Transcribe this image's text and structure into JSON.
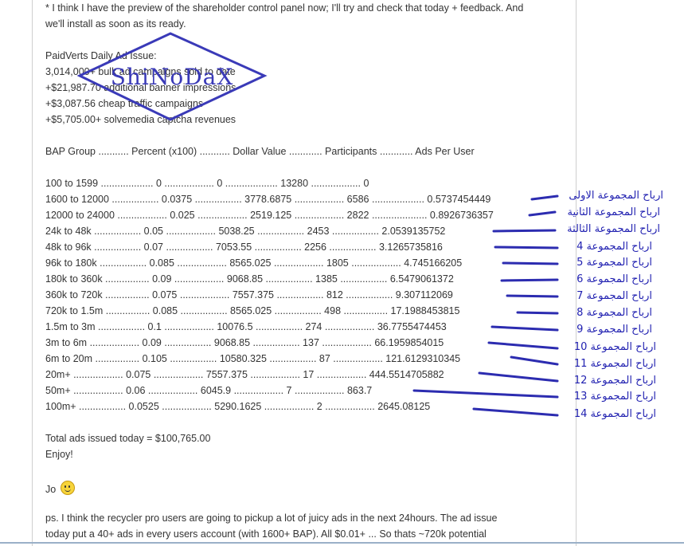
{
  "post": {
    "intro_line1": "* I think I have the preview of the shareholder control panel now; I'll try and check that today + feedback. And",
    "intro_line2": "we'll install as soon as its ready.",
    "issue_title": "PaidVerts Daily Ad Issue:",
    "issue_items": [
      "3,014,000+ bulk ad campaigns sold to date",
      "+$21,987.70 additional banner impressions",
      "+$3,087.56 cheap traffic campaigns",
      "+$5,705.00+ solvemedia captcha revenues"
    ],
    "table_header": "BAP Group ........... Percent (x100) ........... Dollar Value ............ Participants ............ Ads Per User",
    "table_rows": [
      "100 to 1599 ................... 0 .................. 0 ................... 13280 .................. 0",
      "1600 to 12000 ................. 0.0375 ................. 3778.6875 .................. 6586 ................... 0.5737454449",
      "12000 to 24000 .................. 0.025 .................. 2519.125 .................. 2822 .................... 0.8926736357",
      "24k to 48k ................. 0.05 .................. 5038.25 ................. 2453 ................. 2.0539135752",
      "48k to 96k ................. 0.07 ................. 7053.55 ................. 2256 ................. 3.1265735816",
      "96k to 180k ................. 0.085 .................. 8565.025 .................. 1805 .................. 4.745166205",
      "180k to 360k ................ 0.09 .................. 9068.85 ................. 1385 ................. 6.5479061372",
      "360k to 720k ................ 0.075 .................. 7557.375 ................. 812 ................. 9.307112069",
      "720k to 1.5m ................ 0.085 ................. 8565.025 ................. 498 ................ 17.1988453815",
      "1.5m to 3m ................. 0.1 .................. 10076.5 ................. 274 .................. 36.7755474453",
      "3m to 6m .................. 0.09 ................. 9068.85 ................. 137 .................. 66.1959854015",
      "6m to 20m ................ 0.105 ................. 10580.325 ................. 87 .................. 121.6129310345",
      "20m+ .................. 0.075 .................. 7557.375 .................. 17 .................. 444.5514705882",
      "50m+ .................. 0.06 .................. 6045.9 .................. 7 .................. 863.7",
      "100m+ ................. 0.0525 .................. 5290.1625 .................. 2 .................. 2645.08125"
    ],
    "total": "Total ads issued today = $100,765.00",
    "enjoy": "Enjoy!",
    "signature": "Jo",
    "ps_line1": "ps. I think the recycler pro users are going to pickup a lot of juicy ads in the next 24hours. The ad issue",
    "ps_line2": "today put a 40+ ads in every users account (with 1600+ BAP). All $0.01+ ... So thats ~720k potential"
  },
  "annotations": [
    "ارباح المجموعة الاولى",
    "ارباح المجموعة الثانية",
    "ارباح المجموعة الثالثة",
    "ارباح المجموعة 4",
    "ارباح المجموعة 5",
    "ارباح المجموعة 6",
    "ارباح المجموعة 7",
    "ارباح المجموعة 8",
    "ارباح المجموعة 9",
    "ارباح المجموعة 10",
    "ارباح المجموعة 11",
    "ارباح المجموعة 12",
    "ارباح المجموعة 13",
    "ارباح المجموعة 14"
  ],
  "watermark": "ShiNoDaX",
  "colors": {
    "text": "#333333",
    "annotation": "#1f1fb0",
    "pointer_line": "#2c2cb0",
    "watermark": "#3a3ab8"
  },
  "icons": {
    "smiley": "smiley-face-icon"
  }
}
